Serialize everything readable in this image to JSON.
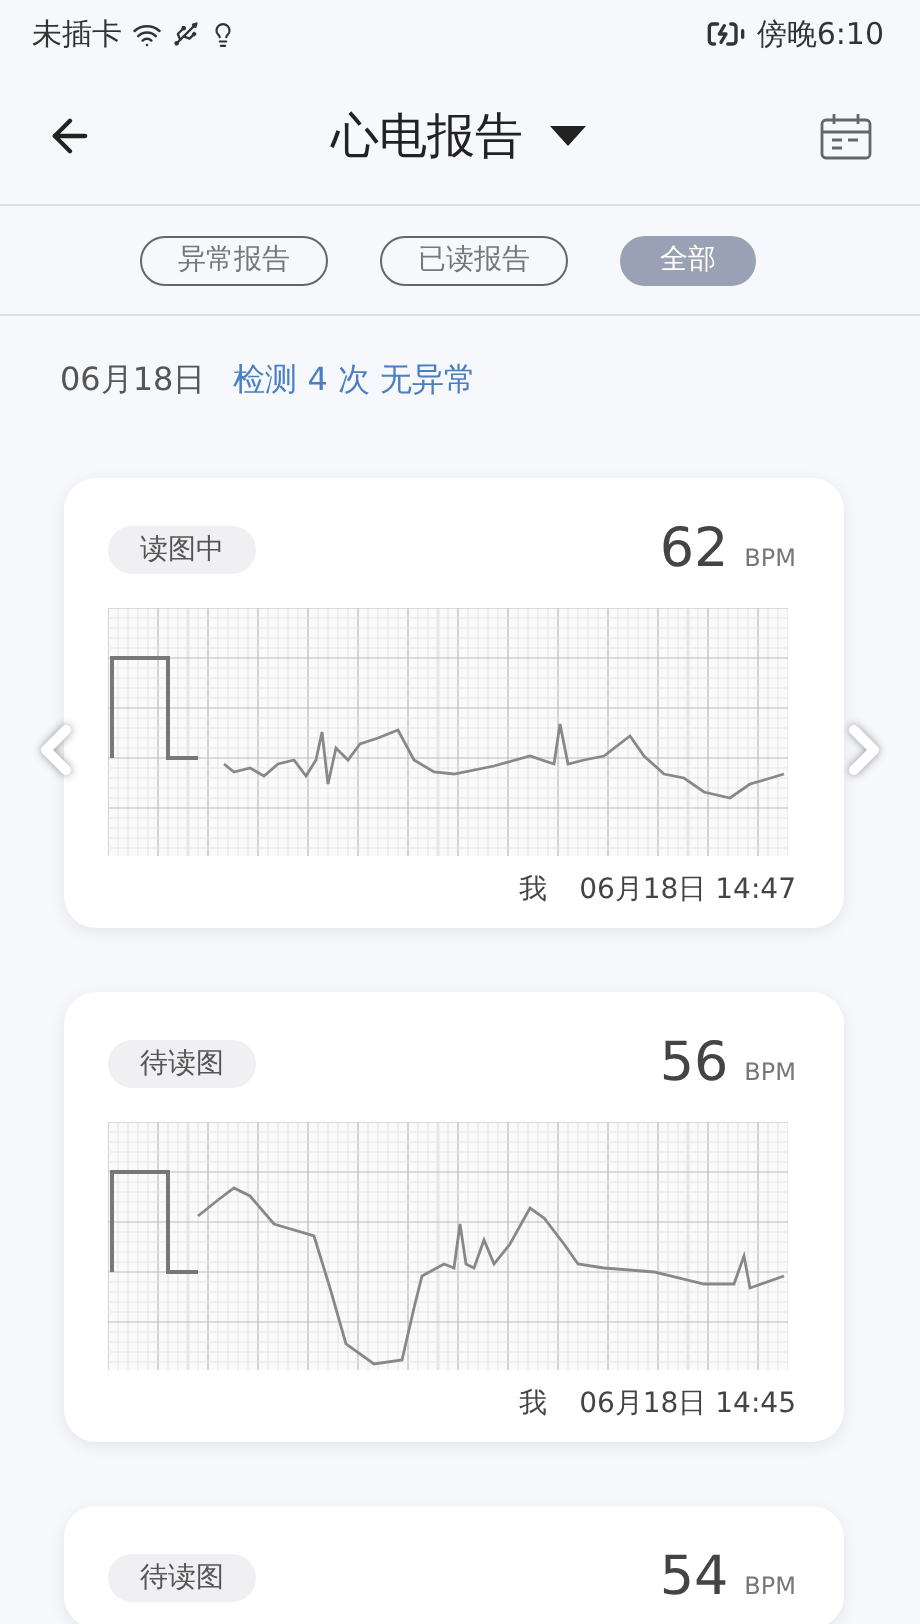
{
  "status_bar": {
    "carrier": "未插卡",
    "time": "傍晚6:10"
  },
  "header": {
    "title": "心电报告"
  },
  "filters": [
    {
      "label": "异常报告",
      "selected": false
    },
    {
      "label": "已读报告",
      "selected": false
    },
    {
      "label": "全部",
      "selected": true
    }
  ],
  "summary": {
    "date": "06月18日",
    "result": "检测 4 次 无异常"
  },
  "reports": [
    {
      "status": "读图中",
      "bpm": "62",
      "unit": "BPM",
      "owner": "我",
      "time": "06月18日 14:47"
    },
    {
      "status": "待读图",
      "bpm": "56",
      "unit": "BPM",
      "owner": "我",
      "time": "06月18日 14:45"
    },
    {
      "status": "待读图",
      "bpm": "54",
      "unit": "BPM"
    }
  ]
}
